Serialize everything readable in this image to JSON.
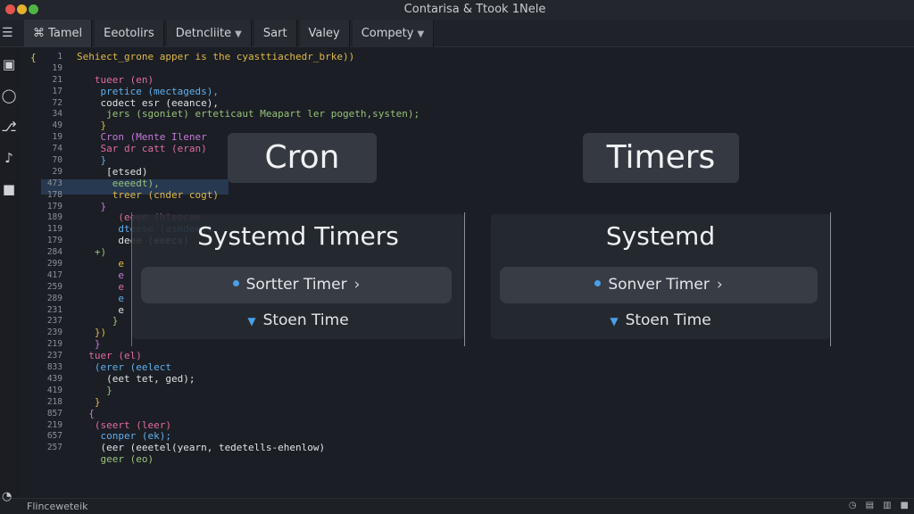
{
  "window": {
    "title": "Contarisa & Ttook 1Nele"
  },
  "tabs": [
    {
      "label": "Tamel",
      "active": true,
      "icon": "code-icon"
    },
    {
      "label": "Eeotolirs",
      "active": false
    },
    {
      "label": "Detncliite",
      "active": false,
      "dropdown": true
    },
    {
      "label": "Sart",
      "active": false
    },
    {
      "label": "Valey",
      "active": false
    },
    {
      "label": "Compety",
      "active": false,
      "dropdown": true
    }
  ],
  "line_numbers": [
    "1",
    "19",
    "21",
    "17",
    "72",
    "34",
    "49",
    "19",
    "74",
    "70",
    "29",
    "473",
    "178",
    "179",
    "189",
    "119",
    "179",
    "284",
    "299",
    "417",
    "259",
    "289",
    "231",
    "237",
    "239",
    "219",
    "237",
    "833",
    "439",
    "419",
    "218",
    "857",
    "219",
    "657",
    "257"
  ],
  "code_lines": [
    "Sehiect_grone apper is the cyasttiachedr_brke))",
    "",
    "   tueer (en)",
    "    pretice (mectageds),",
    "    codect esr (eeance),",
    "     jers (sgoniet) erteticaut Meapart ler pogeth,systen);",
    "    }",
    "    Cron (Mente Ilener",
    "    Sar dr catt (eran)",
    "    }",
    "     [etsed)",
    "      eeeedt),",
    "      treer (cnder cogt)",
    "    }",
    "       (eeee (hteecee",
    "       dteese (asmdeeet",
    "       deee (eeecs)",
    "   +)",
    "       e",
    "       e",
    "       e",
    "       e",
    "       e",
    "      }",
    "   })",
    "   }",
    "  tuer (el)",
    "   (erer (eelect",
    "     (eet tet, ged);",
    "     }",
    "   }",
    "  {",
    "   (seert (leer)",
    "    conper (ek);",
    "    (eer (eeetel(yearn, tedetells-ehenlow)",
    "    geer (eo)"
  ],
  "overlay": {
    "left_label": "Cron",
    "right_label": "Timers",
    "left_card": {
      "title": "Systemd Timers",
      "pill": "Sortter Timer",
      "sub": "Stoen Time"
    },
    "right_card": {
      "title": "Systemd",
      "pill": "Sonver Timer",
      "sub": "Stoen Time"
    }
  },
  "status": {
    "left": "Flinceweteik"
  },
  "colors": {
    "accent": "#4b9fe8",
    "background": "#1b1e24"
  }
}
